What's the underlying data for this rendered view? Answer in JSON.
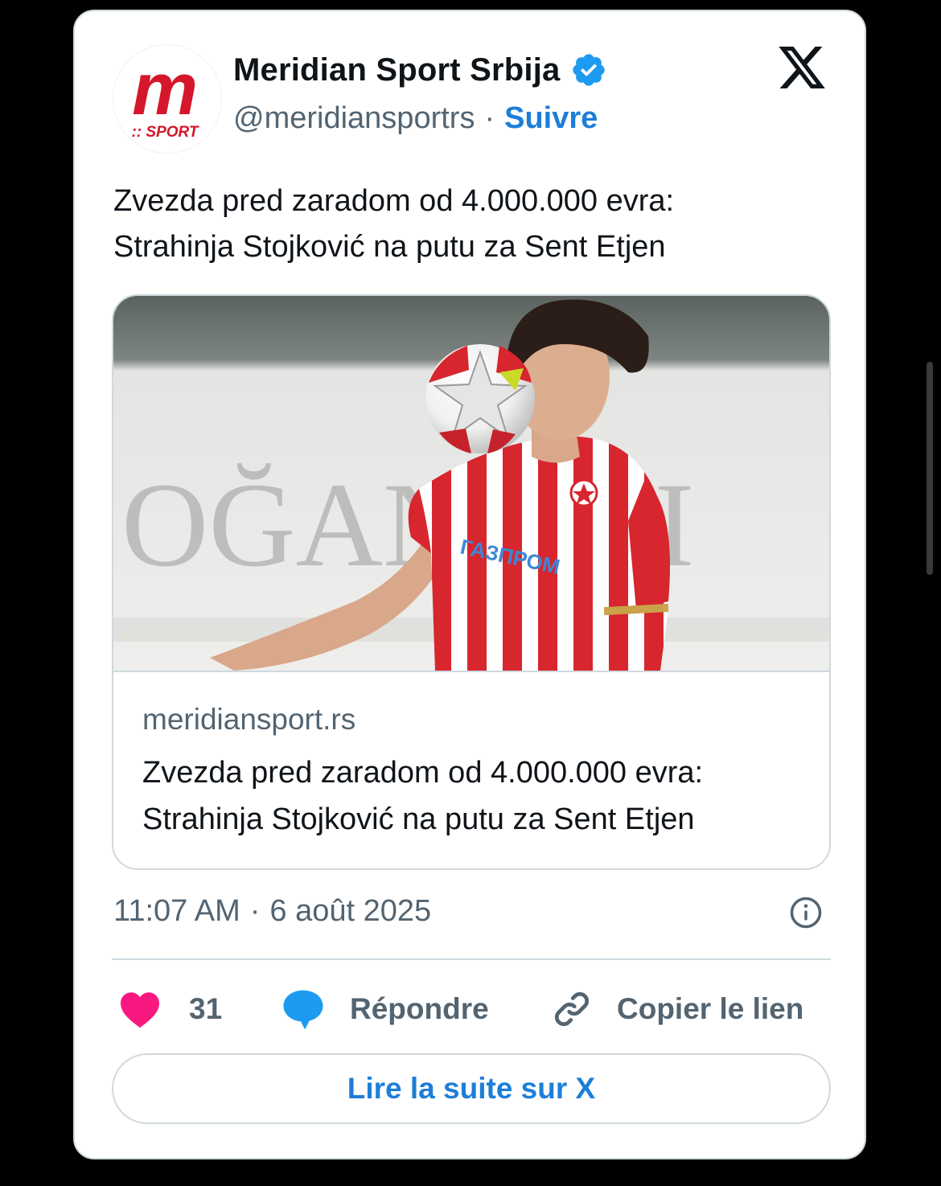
{
  "account": {
    "display_name": "Meridian Sport Srbija",
    "handle": "@meridiansportrs",
    "separator": "·",
    "follow_label": "Suivre",
    "avatar_logo_letter": "m",
    "avatar_logo_sub": ":: SPORT",
    "verified": true
  },
  "tweet": {
    "text_line1": "Zvezda pred zaradom od 4.000.000 evra:",
    "text_line2": "Strahinja Stojković na putu za Sent Etjen",
    "time": "11:07 AM",
    "separator": "·",
    "date": "6 août 2025"
  },
  "link_card": {
    "domain": "meridiansport.rs",
    "title_line1": "Zvezda pred zaradom od 4.000.000 evra:",
    "title_line2": "Strahinja Stojković na putu za Sent Etjen",
    "image_background_text": "OĞAN   ALI",
    "jersey_sponsor": "ГАЗПРОМ"
  },
  "actions": {
    "like_count": "31",
    "reply_label": "Répondre",
    "copy_link_label": "Copier le lien"
  },
  "read_more_label": "Lire la suite sur X",
  "icons": {
    "verified": "verified-badge-icon",
    "x_logo": "x-logo-icon",
    "info": "info-icon",
    "like": "heart-icon",
    "reply": "speech-bubble-icon",
    "copy": "link-icon"
  },
  "colors": {
    "accent": "#1d7ed9",
    "heart": "#f91880",
    "reply_bubble": "#1d9bf0",
    "text_primary": "#0f1419",
    "text_secondary": "#536471",
    "border": "#cfd9de",
    "brand_red": "#d4172a"
  }
}
